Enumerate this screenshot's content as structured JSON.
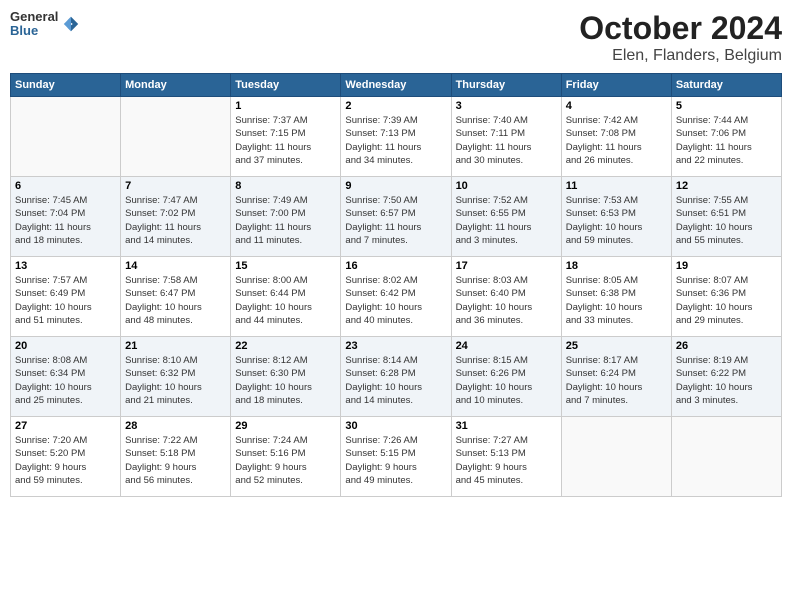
{
  "header": {
    "logo_line1": "General",
    "logo_line2": "Blue",
    "title": "October 2024",
    "subtitle": "Elen, Flanders, Belgium"
  },
  "weekdays": [
    "Sunday",
    "Monday",
    "Tuesday",
    "Wednesday",
    "Thursday",
    "Friday",
    "Saturday"
  ],
  "weeks": [
    [
      {
        "day": "",
        "detail": ""
      },
      {
        "day": "",
        "detail": ""
      },
      {
        "day": "1",
        "detail": "Sunrise: 7:37 AM\nSunset: 7:15 PM\nDaylight: 11 hours\nand 37 minutes."
      },
      {
        "day": "2",
        "detail": "Sunrise: 7:39 AM\nSunset: 7:13 PM\nDaylight: 11 hours\nand 34 minutes."
      },
      {
        "day": "3",
        "detail": "Sunrise: 7:40 AM\nSunset: 7:11 PM\nDaylight: 11 hours\nand 30 minutes."
      },
      {
        "day": "4",
        "detail": "Sunrise: 7:42 AM\nSunset: 7:08 PM\nDaylight: 11 hours\nand 26 minutes."
      },
      {
        "day": "5",
        "detail": "Sunrise: 7:44 AM\nSunset: 7:06 PM\nDaylight: 11 hours\nand 22 minutes."
      }
    ],
    [
      {
        "day": "6",
        "detail": "Sunrise: 7:45 AM\nSunset: 7:04 PM\nDaylight: 11 hours\nand 18 minutes."
      },
      {
        "day": "7",
        "detail": "Sunrise: 7:47 AM\nSunset: 7:02 PM\nDaylight: 11 hours\nand 14 minutes."
      },
      {
        "day": "8",
        "detail": "Sunrise: 7:49 AM\nSunset: 7:00 PM\nDaylight: 11 hours\nand 11 minutes."
      },
      {
        "day": "9",
        "detail": "Sunrise: 7:50 AM\nSunset: 6:57 PM\nDaylight: 11 hours\nand 7 minutes."
      },
      {
        "day": "10",
        "detail": "Sunrise: 7:52 AM\nSunset: 6:55 PM\nDaylight: 11 hours\nand 3 minutes."
      },
      {
        "day": "11",
        "detail": "Sunrise: 7:53 AM\nSunset: 6:53 PM\nDaylight: 10 hours\nand 59 minutes."
      },
      {
        "day": "12",
        "detail": "Sunrise: 7:55 AM\nSunset: 6:51 PM\nDaylight: 10 hours\nand 55 minutes."
      }
    ],
    [
      {
        "day": "13",
        "detail": "Sunrise: 7:57 AM\nSunset: 6:49 PM\nDaylight: 10 hours\nand 51 minutes."
      },
      {
        "day": "14",
        "detail": "Sunrise: 7:58 AM\nSunset: 6:47 PM\nDaylight: 10 hours\nand 48 minutes."
      },
      {
        "day": "15",
        "detail": "Sunrise: 8:00 AM\nSunset: 6:44 PM\nDaylight: 10 hours\nand 44 minutes."
      },
      {
        "day": "16",
        "detail": "Sunrise: 8:02 AM\nSunset: 6:42 PM\nDaylight: 10 hours\nand 40 minutes."
      },
      {
        "day": "17",
        "detail": "Sunrise: 8:03 AM\nSunset: 6:40 PM\nDaylight: 10 hours\nand 36 minutes."
      },
      {
        "day": "18",
        "detail": "Sunrise: 8:05 AM\nSunset: 6:38 PM\nDaylight: 10 hours\nand 33 minutes."
      },
      {
        "day": "19",
        "detail": "Sunrise: 8:07 AM\nSunset: 6:36 PM\nDaylight: 10 hours\nand 29 minutes."
      }
    ],
    [
      {
        "day": "20",
        "detail": "Sunrise: 8:08 AM\nSunset: 6:34 PM\nDaylight: 10 hours\nand 25 minutes."
      },
      {
        "day": "21",
        "detail": "Sunrise: 8:10 AM\nSunset: 6:32 PM\nDaylight: 10 hours\nand 21 minutes."
      },
      {
        "day": "22",
        "detail": "Sunrise: 8:12 AM\nSunset: 6:30 PM\nDaylight: 10 hours\nand 18 minutes."
      },
      {
        "day": "23",
        "detail": "Sunrise: 8:14 AM\nSunset: 6:28 PM\nDaylight: 10 hours\nand 14 minutes."
      },
      {
        "day": "24",
        "detail": "Sunrise: 8:15 AM\nSunset: 6:26 PM\nDaylight: 10 hours\nand 10 minutes."
      },
      {
        "day": "25",
        "detail": "Sunrise: 8:17 AM\nSunset: 6:24 PM\nDaylight: 10 hours\nand 7 minutes."
      },
      {
        "day": "26",
        "detail": "Sunrise: 8:19 AM\nSunset: 6:22 PM\nDaylight: 10 hours\nand 3 minutes."
      }
    ],
    [
      {
        "day": "27",
        "detail": "Sunrise: 7:20 AM\nSunset: 5:20 PM\nDaylight: 9 hours\nand 59 minutes."
      },
      {
        "day": "28",
        "detail": "Sunrise: 7:22 AM\nSunset: 5:18 PM\nDaylight: 9 hours\nand 56 minutes."
      },
      {
        "day": "29",
        "detail": "Sunrise: 7:24 AM\nSunset: 5:16 PM\nDaylight: 9 hours\nand 52 minutes."
      },
      {
        "day": "30",
        "detail": "Sunrise: 7:26 AM\nSunset: 5:15 PM\nDaylight: 9 hours\nand 49 minutes."
      },
      {
        "day": "31",
        "detail": "Sunrise: 7:27 AM\nSunset: 5:13 PM\nDaylight: 9 hours\nand 45 minutes."
      },
      {
        "day": "",
        "detail": ""
      },
      {
        "day": "",
        "detail": ""
      }
    ]
  ]
}
